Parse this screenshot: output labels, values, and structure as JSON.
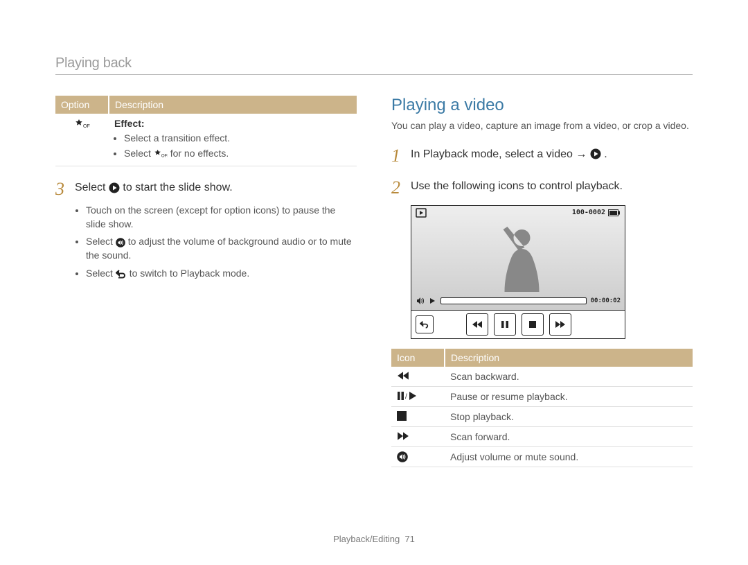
{
  "section_title": "Playing back",
  "left": {
    "table": {
      "headers": [
        "Option",
        "Description"
      ],
      "effect_label": "Effect:",
      "effect_items": [
        "Select a transition effect.",
        "Select ",
        " for no effects."
      ]
    },
    "step3": {
      "num": "3",
      "pre": "Select ",
      "post": " to start the slide show."
    },
    "bullets": [
      {
        "pre": "Touch on the screen (except for option icons) to pause the slide show."
      },
      {
        "pre": "Select ",
        "post": " to adjust the volume of background audio or to mute the sound."
      },
      {
        "pre": "Select ",
        "post": " to switch to Playback mode."
      }
    ]
  },
  "right": {
    "heading": "Playing a video",
    "intro": "You can play a video, capture an image from a video, or crop a video.",
    "step1": {
      "num": "1",
      "pre": "In Playback mode, select a video → ",
      "post": "."
    },
    "step2": {
      "num": "2",
      "text": "Use the following icons to control playback."
    },
    "player": {
      "file": "100-0002",
      "time": "00:00:02"
    },
    "icon_table": {
      "headers": [
        "Icon",
        "Description"
      ],
      "rows": [
        {
          "desc": "Scan backward."
        },
        {
          "desc": "Pause or resume playback."
        },
        {
          "desc": "Stop playback."
        },
        {
          "desc": "Scan forward."
        },
        {
          "desc": "Adjust volume or mute sound."
        }
      ]
    }
  },
  "footer": {
    "label": "Playback/Editing",
    "page": "71"
  }
}
